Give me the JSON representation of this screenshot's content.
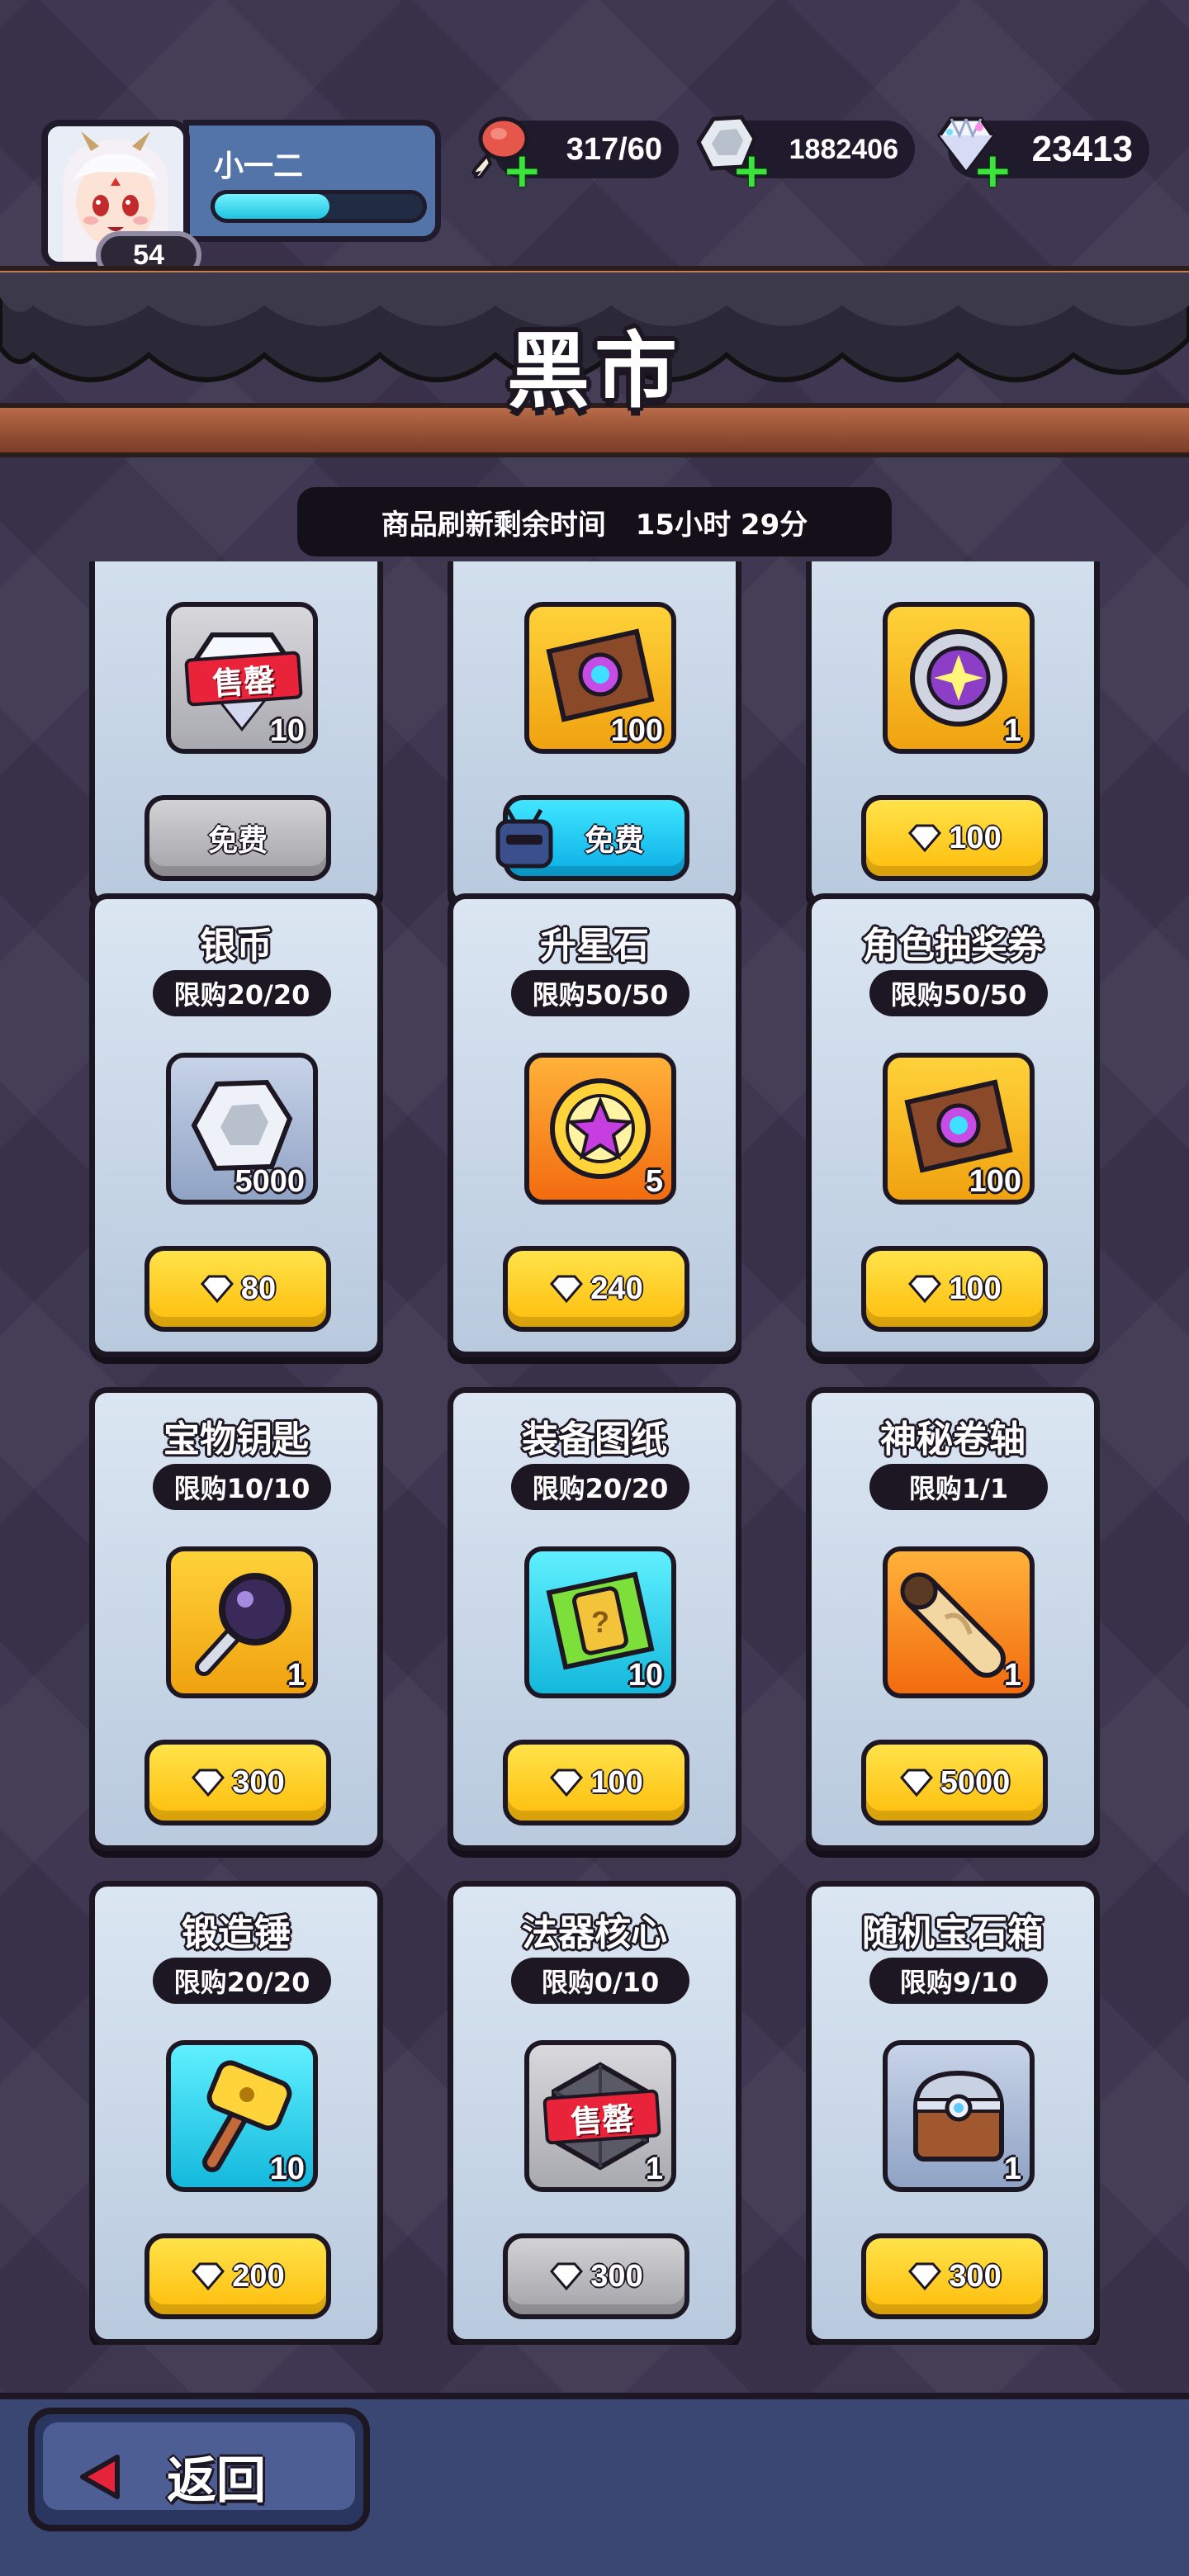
{
  "player": {
    "name": "小一二",
    "level": "54",
    "exp_progress": 0.55
  },
  "resources": {
    "stamina": "317/60",
    "silver": "1882406",
    "gems": "23413"
  },
  "header": {
    "title": "黑市"
  },
  "refresh": {
    "label": "商品刷新剩余时间",
    "time": "15小时 29分"
  },
  "shop": {
    "row0": [
      {
        "qty": "10",
        "sold_stamp": "售罄",
        "price": "免费"
      },
      {
        "qty": "100",
        "price": "免费"
      },
      {
        "qty": "1",
        "price": "100"
      }
    ],
    "row1": [
      {
        "name": "银币",
        "limit": "限购20/20",
        "qty": "5000",
        "price": "80"
      },
      {
        "name": "升星石",
        "limit": "限购50/50",
        "qty": "5",
        "price": "240"
      },
      {
        "name": "角色抽奖券",
        "limit": "限购50/50",
        "qty": "100",
        "price": "100"
      }
    ],
    "row2": [
      {
        "name": "宝物钥匙",
        "limit": "限购10/10",
        "qty": "1",
        "price": "300"
      },
      {
        "name": "装备图纸",
        "limit": "限购20/20",
        "qty": "10",
        "price": "100"
      },
      {
        "name": "神秘卷轴",
        "limit": "限购1/1",
        "qty": "1",
        "price": "5000"
      }
    ],
    "row3": [
      {
        "name": "锻造锤",
        "limit": "限购20/20",
        "qty": "10",
        "price": "200"
      },
      {
        "name": "法器核心",
        "limit": "限购0/10",
        "qty": "1",
        "sold_stamp": "售罄",
        "price": "300"
      },
      {
        "name": "随机宝石箱",
        "limit": "限购9/10",
        "qty": "1",
        "price": "300"
      }
    ]
  },
  "footer": {
    "back_label": "返回"
  },
  "colors": {
    "background": "#3d3550",
    "card": "#dbe6f2",
    "price_button": "#ffd21f",
    "exp_bar": "#2fd6ec"
  }
}
